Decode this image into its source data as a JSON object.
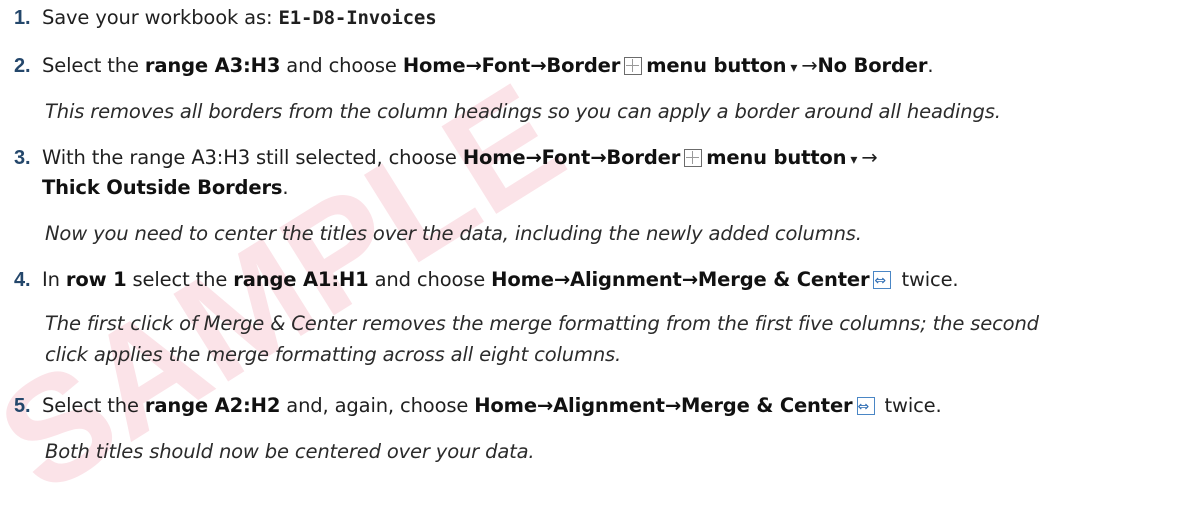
{
  "watermark": {
    "text": "SAMPLE"
  },
  "steps": [
    {
      "number": "1.",
      "text_a": "Save your workbook as: ",
      "filename": "E1-D8-Invoices"
    },
    {
      "number": "2.",
      "text_a": "Select the ",
      "bold_range": "range A3:H3",
      "text_b": " and choose ",
      "path": "Home→Font→Border",
      "menu_button": "menu button",
      "dropdown_glyph": "▾",
      "arrow": "→",
      "option": "No Border",
      "end": ".",
      "note": "This removes all borders from the column headings so you can apply a border around all headings."
    },
    {
      "number": "3.",
      "text_a": "With the range A3:H3 still selected, choose ",
      "path": "Home→Font→Border",
      "menu_button": "menu button",
      "dropdown_glyph": "▾",
      "arrow": "→",
      "option": "Thick Outside Borders",
      "end": ".",
      "note": "Now you need to center the titles over the data, including the newly added columns."
    },
    {
      "number": "4.",
      "text_a": "In ",
      "bold_row": "row 1",
      "text_b": " select the ",
      "bold_range": "range A1:H1",
      "text_c": " and choose ",
      "path": "Home→Alignment→Merge & Center",
      "end": " twice.",
      "note_line1": "The first click of Merge & Center removes the merge formatting from the first five columns; the second",
      "note_line2": "click applies the merge formatting across all eight columns."
    },
    {
      "number": "5.",
      "text_a": "Select the ",
      "bold_range": "range A2:H2",
      "text_b": " and, again, choose ",
      "path": "Home→Alignment→Merge & Center",
      "end": " twice.",
      "note": "Both titles should now be centered over your data."
    }
  ]
}
